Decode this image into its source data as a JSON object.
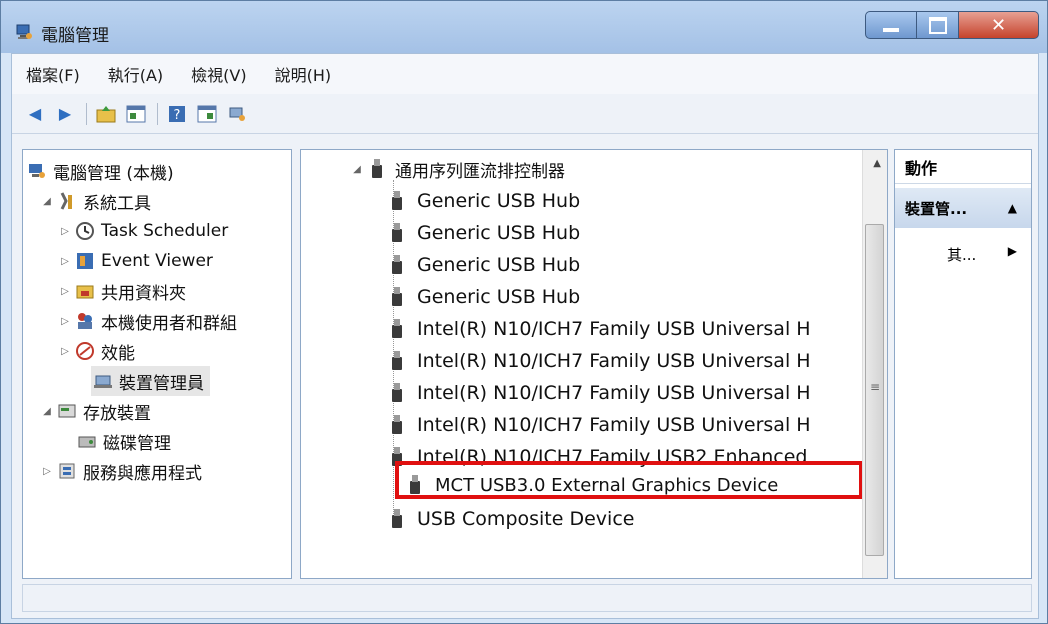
{
  "window": {
    "title": "電腦管理"
  },
  "menu": [
    {
      "label": "檔案(F)"
    },
    {
      "label": "執行(A)"
    },
    {
      "label": "檢視(V)"
    },
    {
      "label": "說明(H)"
    }
  ],
  "toolbar": {
    "buttons": [
      "back-icon",
      "forward-icon",
      "up-folder-icon",
      "show-hide-tree-icon",
      "help-icon",
      "properties-icon",
      "scan-hardware-icon"
    ]
  },
  "left_tree": {
    "root": "電腦管理 (本機)",
    "system_tools": "系統工具",
    "task_scheduler": "Task Scheduler",
    "event_viewer": "Event Viewer",
    "shared_folders": "共用資料夾",
    "local_users": "本機使用者和群組",
    "performance": "效能",
    "device_manager": "裝置管理員",
    "storage": "存放裝置",
    "disk_management": "磁碟管理",
    "services": "服務與應用程式"
  },
  "device_tree": {
    "category": "通用序列匯流排控制器",
    "devices": [
      "Generic USB Hub",
      "Generic USB Hub",
      "Generic USB Hub",
      "Generic USB Hub",
      "Intel(R) N10/ICH7 Family USB Universal H",
      "Intel(R) N10/ICH7 Family USB Universal H",
      "Intel(R) N10/ICH7 Family USB Universal H",
      "Intel(R) N10/ICH7 Family USB Universal H",
      "Intel(R) N10/ICH7 Family USB2 Enhanced",
      "MCT USB3.0 External Graphics Device",
      "USB Composite Device"
    ],
    "highlighted_index": 9,
    "highlight_color": "#e01010"
  },
  "actions": {
    "header": "動作",
    "section": "裝置管...",
    "item": "其..."
  }
}
